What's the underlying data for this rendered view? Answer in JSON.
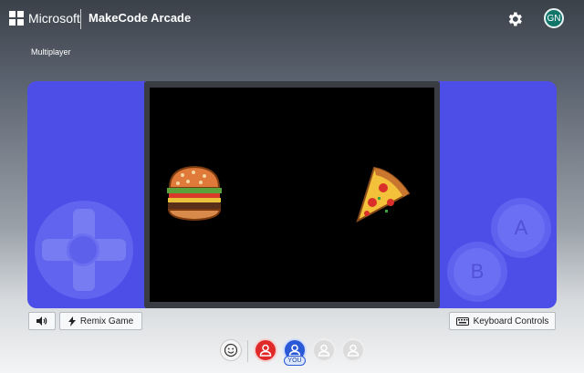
{
  "header": {
    "brand": "Microsoft",
    "app_title": "MakeCode Arcade",
    "user_initials": "GN",
    "icons": [
      "windows-logo-icon",
      "gear-icon"
    ]
  },
  "page": {
    "mode_label": "Multiplayer"
  },
  "controller": {
    "a_label": "A",
    "b_label": "B",
    "console_color": "#4d4ee8",
    "screen_sprites": [
      "burger-sprite",
      "pizza-sprite"
    ]
  },
  "toolbar": {
    "mute_icon": "speaker-icon",
    "remix_label": "Remix Game",
    "remix_icon": "lightning-icon",
    "keyboard_label": "Keyboard Controls",
    "keyboard_icon": "keyboard-icon"
  },
  "players": {
    "you_label": "YOU",
    "emote_icon": "smiley-icon",
    "slots": [
      {
        "color": "#e02a2a",
        "state": "active"
      },
      {
        "color": "#2a59d6",
        "state": "you"
      },
      {
        "color": "#dcdcdc",
        "state": "empty"
      },
      {
        "color": "#dcdcdc",
        "state": "empty"
      }
    ]
  }
}
